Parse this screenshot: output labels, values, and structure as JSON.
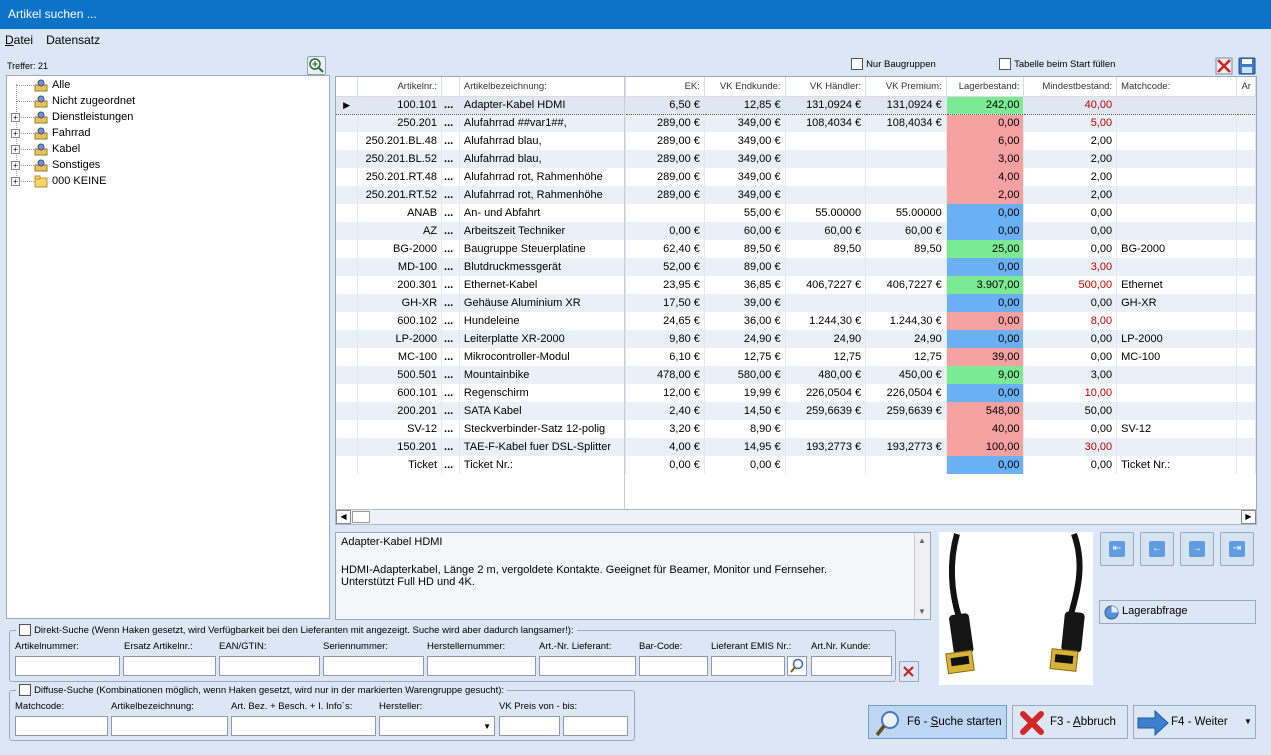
{
  "window": {
    "title": "Artikel suchen ..."
  },
  "menu": [
    {
      "acc": "D",
      "rest": "atei"
    },
    {
      "acc": "",
      "rest": "Datensatz"
    }
  ],
  "tree": {
    "hits": "Treffer: 21",
    "items": [
      {
        "label": "Alle",
        "expandable": false
      },
      {
        "label": "Nicht zugeordnet",
        "expandable": false
      },
      {
        "label": "Dienstleistungen",
        "expandable": true
      },
      {
        "label": "Fahrrad",
        "expandable": true
      },
      {
        "label": "Kabel",
        "expandable": true
      },
      {
        "label": "Sonstiges",
        "expandable": true
      },
      {
        "label": "000 KEINE",
        "expandable": true
      }
    ]
  },
  "options": {
    "nur_baugruppen": "Nur Baugruppen",
    "tabelle_fuellen": "Tabelle beim Start füllen"
  },
  "grid": {
    "headers": [
      "",
      "Artikelnr.:",
      "",
      "Artikelbezeichnung:",
      "EK:",
      "VK Endkunde:",
      "VK Händler:",
      "VK Premium:",
      "Lagerbestand:",
      "Mindestbestand:",
      "Matchcode:",
      "Ar"
    ],
    "rows": [
      {
        "nr": "100.101",
        "name": "Adapter-Kabel HDMI",
        "ek": "6,50 €",
        "vke": "12,85 €",
        "vkh": "131,0924 €",
        "vkp": "131,0924 €",
        "lager": "242,00",
        "lc": "green",
        "min": "40,00",
        "mr": true,
        "mc": "",
        "sel": true
      },
      {
        "nr": "250.201",
        "name": "Alufahrrad ##var1##,",
        "ek": "289,00 €",
        "vke": "349,00 €",
        "vkh": "108,4034 €",
        "vkp": "108,4034 €",
        "lager": "0,00",
        "lc": "red",
        "min": "5,00",
        "mr": true,
        "mc": ""
      },
      {
        "nr": "250.201.BL.48",
        "name": "Alufahrrad blau,",
        "ek": "289,00 €",
        "vke": "349,00 €",
        "vkh": "",
        "vkp": "",
        "lager": "6,00",
        "lc": "red",
        "min": "2,00",
        "mr": false,
        "mc": ""
      },
      {
        "nr": "250.201.BL.52",
        "name": "Alufahrrad blau,",
        "ek": "289,00 €",
        "vke": "349,00 €",
        "vkh": "",
        "vkp": "",
        "lager": "3,00",
        "lc": "red",
        "min": "2,00",
        "mr": false,
        "mc": ""
      },
      {
        "nr": "250.201.RT.48",
        "name": "Alufahrrad rot, Rahmenhöhe",
        "ek": "289,00 €",
        "vke": "349,00 €",
        "vkh": "",
        "vkp": "",
        "lager": "4,00",
        "lc": "red",
        "min": "2,00",
        "mr": false,
        "mc": ""
      },
      {
        "nr": "250.201.RT.52",
        "name": "Alufahrrad rot, Rahmenhöhe",
        "ek": "289,00 €",
        "vke": "349,00 €",
        "vkh": "",
        "vkp": "",
        "lager": "2,00",
        "lc": "red",
        "min": "2,00",
        "mr": false,
        "mc": ""
      },
      {
        "nr": "ANAB",
        "name": "An- und Abfahrt",
        "ek": "",
        "vke": "55,00 €",
        "vkh": "55.00000",
        "vkp": "55.00000",
        "lager": "0,00",
        "lc": "blue",
        "min": "0,00",
        "mr": false,
        "mc": ""
      },
      {
        "nr": "AZ",
        "name": "Arbeitszeit Techniker",
        "ek": "0,00 €",
        "vke": "60,00 €",
        "vkh": "60,00 €",
        "vkp": "60,00 €",
        "lager": "0,00",
        "lc": "blue",
        "min": "0,00",
        "mr": false,
        "mc": ""
      },
      {
        "nr": "BG-2000",
        "name": "Baugruppe Steuerplatine",
        "ek": "62,40 €",
        "vke": "89,50 €",
        "vkh": "89,50",
        "vkp": "89,50",
        "lager": "25,00",
        "lc": "green",
        "min": "0,00",
        "mr": false,
        "mc": "BG-2000"
      },
      {
        "nr": "MD-100",
        "name": "Blutdruckmessgerät",
        "ek": "52,00 €",
        "vke": "89,00 €",
        "vkh": "",
        "vkp": "",
        "lager": "0,00",
        "lc": "blue",
        "min": "3,00",
        "mr": true,
        "mc": ""
      },
      {
        "nr": "200.301",
        "name": "Ethernet-Kabel",
        "ek": "23,95 €",
        "vke": "36,85 €",
        "vkh": "406,7227 €",
        "vkp": "406,7227 €",
        "lager": "3.907,00",
        "lc": "green",
        "min": "500,00",
        "mr": true,
        "mc": "Ethernet"
      },
      {
        "nr": "GH-XR",
        "name": "Gehäuse Aluminium XR",
        "ek": "17,50 €",
        "vke": "39,00 €",
        "vkh": "",
        "vkp": "",
        "lager": "0,00",
        "lc": "blue",
        "min": "0,00",
        "mr": false,
        "mc": "GH-XR"
      },
      {
        "nr": "600.102",
        "name": "Hundeleine",
        "ek": "24,65 €",
        "vke": "36,00 €",
        "vkh": "1.244,30 €",
        "vkp": "1.244,30 €",
        "lager": "0,00",
        "lc": "red",
        "min": "8,00",
        "mr": true,
        "mc": ""
      },
      {
        "nr": "LP-2000",
        "name": "Leiterplatte XR-2000",
        "ek": "9,80 €",
        "vke": "24,90 €",
        "vkh": "24,90",
        "vkp": "24,90",
        "lager": "0,00",
        "lc": "blue",
        "min": "0,00",
        "mr": false,
        "mc": "LP-2000"
      },
      {
        "nr": "MC-100",
        "name": "Mikrocontroller-Modul",
        "ek": "6,10 €",
        "vke": "12,75 €",
        "vkh": "12,75",
        "vkp": "12,75",
        "lager": "39,00",
        "lc": "red",
        "min": "0,00",
        "mr": false,
        "mc": "MC-100"
      },
      {
        "nr": "500.501",
        "name": "Mountainbike",
        "ek": "478,00 €",
        "vke": "580,00 €",
        "vkh": "480,00 €",
        "vkp": "450,00 €",
        "lager": "9,00",
        "lc": "green",
        "min": "3,00",
        "mr": false,
        "mc": ""
      },
      {
        "nr": "600.101",
        "name": "Regenschirm",
        "ek": "12,00 €",
        "vke": "19,99 €",
        "vkh": "226,0504 €",
        "vkp": "226,0504 €",
        "lager": "0,00",
        "lc": "blue",
        "min": "10,00",
        "mr": true,
        "mc": ""
      },
      {
        "nr": "200.201",
        "name": "SATA Kabel",
        "ek": "2,40 €",
        "vke": "14,50 €",
        "vkh": "259,6639 €",
        "vkp": "259,6639 €",
        "lager": "548,00",
        "lc": "red",
        "min": "50,00",
        "mr": false,
        "mc": ""
      },
      {
        "nr": "SV-12",
        "name": "Steckverbinder-Satz 12-polig",
        "ek": "3,20 €",
        "vke": "8,90 €",
        "vkh": "",
        "vkp": "",
        "lager": "40,00",
        "lc": "red",
        "min": "0,00",
        "mr": false,
        "mc": "SV-12"
      },
      {
        "nr": "150.201",
        "name": "TAE-F-Kabel fuer DSL-Splitter",
        "ek": "4,00 €",
        "vke": "14,95 €",
        "vkh": "193,2773 €",
        "vkp": "193,2773 €",
        "lager": "100,00",
        "lc": "red",
        "min": "30,00",
        "mr": true,
        "mc": ""
      },
      {
        "nr": "Ticket",
        "name": "Ticket Nr.:",
        "ek": "0,00 €",
        "vke": "0,00 €",
        "vkh": "",
        "vkp": "",
        "lager": "0,00",
        "lc": "blue",
        "min": "0,00",
        "mr": false,
        "mc": "Ticket Nr.:"
      }
    ]
  },
  "description": {
    "title": "Adapter-Kabel HDMI",
    "line1": "HDMI-Adapterkabel, Länge 2 m, vergoldete Kontakte. Geeignet für Beamer, Monitor und Fernseher.",
    "line2": "Unterstützt Full HD und 4K."
  },
  "nav": {
    "lager": "Lagerabfrage"
  },
  "direkt": {
    "label": "Direkt-Suche (Wenn Haken gesetzt, wird Verfügbarkeit bei den Lieferanten mit angezeigt. Suche wird aber dadurch langsamer!):",
    "fields": [
      "Artikelnummer:",
      "Ersatz Artikelnr.:",
      "EAN/GTIN:",
      "Seriennummer:",
      "Herstellernummer:",
      "Art.-Nr. Lieferant:",
      "Bar-Code:",
      "Lieferant EMIS Nr.:",
      "Art.Nr. Kunde:"
    ]
  },
  "diffuse": {
    "label": "Diffuse-Suche (Kombinationen möglich, wenn Haken gesetzt, wird nur in der markierten Warengruppe gesucht):",
    "fields": [
      "Matchcode:",
      "Artikelbezeichnung:",
      "Art. Bez. + Besch. + I. Info´s:",
      "Hersteller:",
      "VK Preis von - bis:"
    ]
  },
  "buttons": {
    "search": {
      "pre": "F6 - ",
      "acc": "S",
      "post": "uche starten"
    },
    "cancel": {
      "pre": "F3 - ",
      "acc": "A",
      "post": "bbruch"
    },
    "next": "F4 - Weiter"
  },
  "colors": {
    "lager_red": "#f6a1a1",
    "lager_green": "#7bea93",
    "lager_blue": "#6bb0f3",
    "titlebar": "#0a73c8"
  }
}
